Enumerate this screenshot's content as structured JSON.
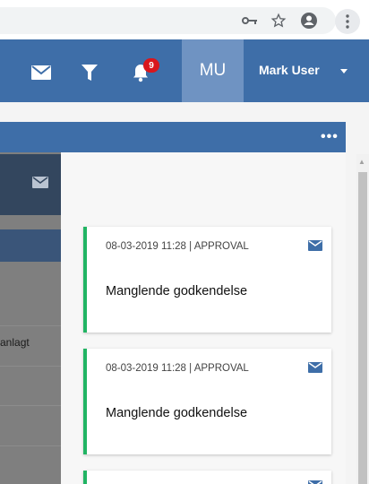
{
  "browser": {
    "icons": [
      "key-icon",
      "star-icon",
      "account-icon",
      "more-vertical-icon"
    ]
  },
  "appbar": {
    "icons": [
      "mail-icon",
      "filter-icon",
      "bell-icon"
    ],
    "notification_count": "9",
    "avatar_initials": "MU",
    "user_name": "Mark User"
  },
  "subbar": {
    "menu_label": "•••"
  },
  "background": {
    "partial_text": "anlagt"
  },
  "notifications": [
    {
      "meta": "08-03-2019 11:28 | APPROVAL",
      "title": "Manglende godkendelse",
      "status_color": "#21b463"
    },
    {
      "meta": "08-03-2019 11:28 | APPROVAL",
      "title": "Manglende godkendelse",
      "status_color": "#21b463"
    },
    {
      "meta": "",
      "title": "",
      "status_color": "#21b463"
    }
  ],
  "colors": {
    "appbar": "#3e6ea8",
    "avatar": "#6f93c2",
    "badge": "#d9161c",
    "card_accent": "#21b463"
  }
}
